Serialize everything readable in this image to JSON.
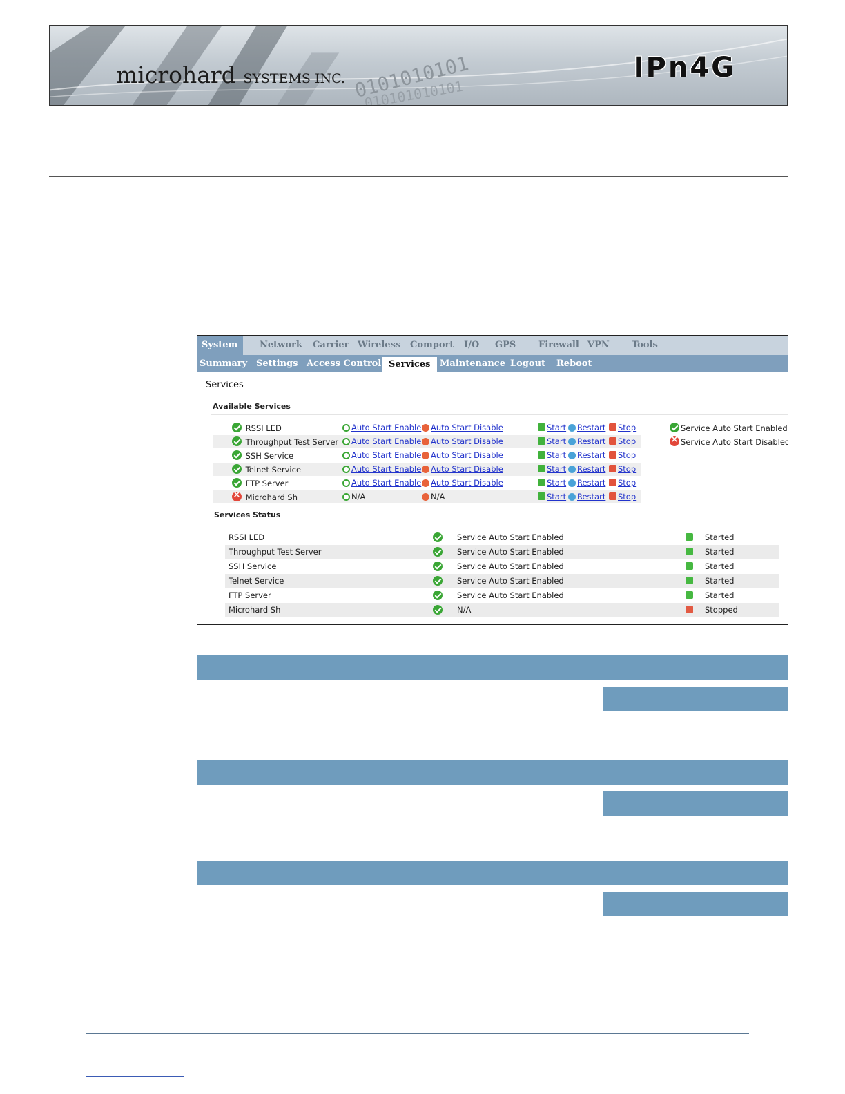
{
  "banner": {
    "company": "microhard",
    "company_suffix": "SYSTEMS INC.",
    "product": "IPn4G",
    "binary_top": "0101010101",
    "binary_bottom": "010101010101"
  },
  "screenshot": {
    "main_tabs": [
      "System",
      "Network",
      "Carrier",
      "Wireless",
      "Comport",
      "I/O",
      "GPS",
      "Firewall",
      "VPN",
      "Tools"
    ],
    "sub_tabs": [
      "Summary",
      "Settings",
      "Access Control",
      "Services",
      "Maintenance",
      "Logout",
      "Reboot"
    ],
    "title": "Services",
    "available_heading": "Available Services",
    "status_heading": "Services Status",
    "available": [
      {
        "name": "RSSI LED",
        "ok": true,
        "enable": "Auto Start Enable",
        "disable": "Auto Start Disable",
        "start": "Start",
        "restart": "Restart",
        "stop": "Stop"
      },
      {
        "name": "Throughput Test Server",
        "ok": true,
        "enable": "Auto Start Enable",
        "disable": "Auto Start Disable",
        "start": "Start",
        "restart": "Restart",
        "stop": "Stop"
      },
      {
        "name": "SSH Service",
        "ok": true,
        "enable": "Auto Start Enable",
        "disable": "Auto Start Disable",
        "start": "Start",
        "restart": "Restart",
        "stop": "Stop"
      },
      {
        "name": "Telnet Service",
        "ok": true,
        "enable": "Auto Start Enable",
        "disable": "Auto Start Disable",
        "start": "Start",
        "restart": "Restart",
        "stop": "Stop"
      },
      {
        "name": "FTP Server",
        "ok": true,
        "enable": "Auto Start Enable",
        "disable": "Auto Start Disable",
        "start": "Start",
        "restart": "Restart",
        "stop": "Stop"
      },
      {
        "name": "Microhard Sh",
        "ok": false,
        "enable": "N/A",
        "disable": "N/A",
        "start": "Start",
        "restart": "Restart",
        "stop": "Stop"
      }
    ],
    "legend": {
      "enabled": "Service Auto Start Enabled",
      "disabled": "Service Auto Start Disabled"
    },
    "status": [
      {
        "name": "RSSI LED",
        "autostart": "Service Auto Start Enabled",
        "state": "Started"
      },
      {
        "name": "Throughput Test Server",
        "autostart": "Service Auto Start Enabled",
        "state": "Started"
      },
      {
        "name": "SSH Service",
        "autostart": "Service Auto Start Enabled",
        "state": "Started"
      },
      {
        "name": "Telnet Service",
        "autostart": "Service Auto Start Enabled",
        "state": "Started"
      },
      {
        "name": "FTP Server",
        "autostart": "Service Auto Start Enabled",
        "state": "Started"
      },
      {
        "name": "Microhard Sh",
        "autostart": "N/A",
        "state": "Stopped"
      }
    ]
  },
  "colors": {
    "bar_blue": "#6f9cbd",
    "nav_active": "#7f9fbd",
    "link": "#2233cc",
    "ok_green": "#3aa635",
    "error_red": "#e2473a"
  }
}
